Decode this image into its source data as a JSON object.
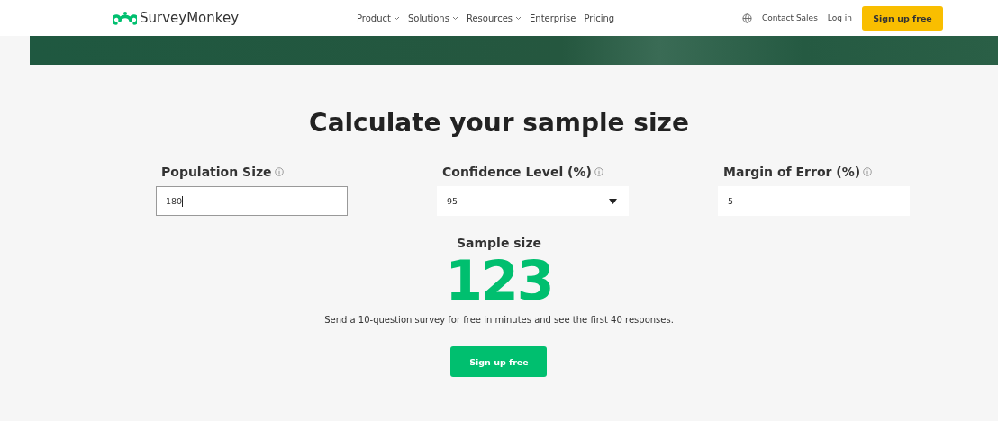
{
  "header": {
    "logo": "SurveyMonkey",
    "nav": [
      {
        "label": "Product",
        "dropdown": true
      },
      {
        "label": "Solutions",
        "dropdown": true
      },
      {
        "label": "Resources",
        "dropdown": true
      },
      {
        "label": "Enterprise",
        "dropdown": false
      },
      {
        "label": "Pricing",
        "dropdown": false
      }
    ],
    "contact": "Contact Sales",
    "login": "Log in",
    "signup": "Sign up free"
  },
  "title": "Calculate your sample size",
  "fields": [
    {
      "kind": "input",
      "label": "Population Size",
      "value": "180",
      "focused": true
    },
    {
      "kind": "select",
      "label": "Confidence Level (%)",
      "value": "95",
      "focused": false
    },
    {
      "kind": "input",
      "label": "Margin of Error (%)",
      "value": "5",
      "focused": false
    }
  ],
  "result": {
    "label": "Sample size",
    "value": "123",
    "note": "Send a 10-question survey for free in minutes and see the first 40 responses.",
    "button": "Sign up free"
  }
}
